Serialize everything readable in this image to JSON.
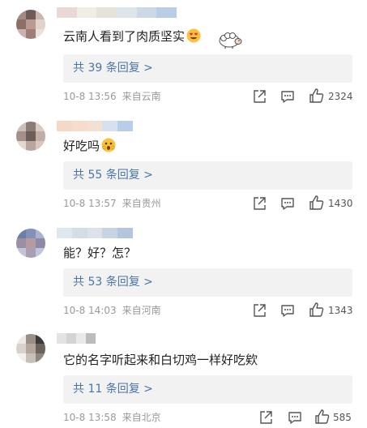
{
  "comments": [
    {
      "text": "云南人看到了肉质坚实",
      "emoji": "heart-eyes-emoji",
      "sticker": "sheep-sticker",
      "replies": "共 39 条回复 >",
      "date": "10-8 13:56",
      "location": "来自云南",
      "likes": "2324"
    },
    {
      "text": "好吃吗",
      "emoji": "surprised-emoji",
      "replies": "共 55 条回复 >",
      "date": "10-8 13:57",
      "location": "来自贵州",
      "likes": "1430"
    },
    {
      "text": "能？好？怎？",
      "replies": "共 53 条回复 >",
      "date": "10-8 14:03",
      "location": "来自河南",
      "likes": "1343"
    },
    {
      "text": "它的名字听起来和白切鸡一样好吃欸",
      "replies": "共 11 条回复 >",
      "date": "10-8 13:58",
      "location": "来自北京",
      "likes": "585"
    }
  ],
  "icons": {
    "share": "share-icon",
    "comment": "comment-icon",
    "like": "thumbs-up-icon"
  },
  "colors": {
    "link": "#4a75a8",
    "reply_bg": "#f2f2f2",
    "meta": "#999999"
  }
}
